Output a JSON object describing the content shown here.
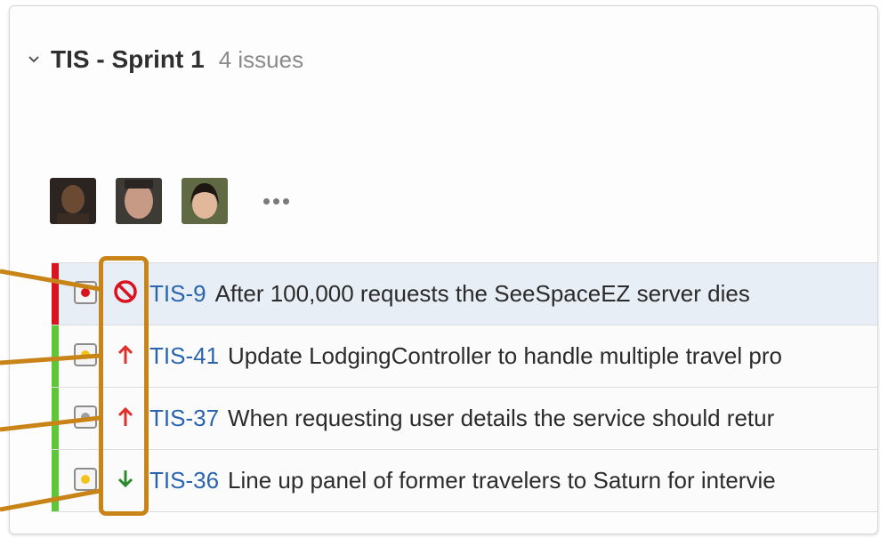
{
  "sprint": {
    "title": "TIS - Sprint 1",
    "issue_count": "4 issues"
  },
  "avatars": [
    {
      "name": "avatar-user-1",
      "colors": [
        "#2b2420",
        "#6b4a34",
        "#3a2c22"
      ]
    },
    {
      "name": "avatar-user-2",
      "colors": [
        "#3e3a36",
        "#c79a86",
        "#d8b2a0"
      ]
    },
    {
      "name": "avatar-user-3",
      "colors": [
        "#5f6a45",
        "#e2b89c",
        "#1d1612"
      ]
    }
  ],
  "issues": [
    {
      "key": "TIS-9",
      "summary": "After 100,000 requests the SeeSpaceEZ server dies",
      "priority": "blocker",
      "priority_icon": "blocker-icon",
      "type": "bug",
      "type_icon": "bug-icon",
      "stripe_color": "#d9141e",
      "priority_color": "#d9141e",
      "selected": true
    },
    {
      "key": "TIS-41",
      "summary": "Update LodgingController to handle multiple travel pro",
      "priority": "critical",
      "priority_icon": "priority-up-icon",
      "type": "improvement",
      "type_icon": "improvement-icon",
      "stripe_color": "#5ec737",
      "priority_color": "#e0302a",
      "selected": false
    },
    {
      "key": "TIS-37",
      "summary": "When requesting user details the service should retur",
      "priority": "major",
      "priority_icon": "priority-up-icon",
      "type": "story",
      "type_icon": "story-icon",
      "stripe_color": "#5ec737",
      "priority_color": "#e0302a",
      "selected": false
    },
    {
      "key": "TIS-36",
      "summary": "Line up panel of former travelers to Saturn for intervie",
      "priority": "minor",
      "priority_icon": "priority-down-icon",
      "type": "improvement",
      "type_icon": "improvement-icon",
      "stripe_color": "#5ec737",
      "priority_color": "#2a8b2a",
      "selected": false
    }
  ],
  "colors": {
    "highlight": "#c98418",
    "link": "#2a64b0"
  }
}
